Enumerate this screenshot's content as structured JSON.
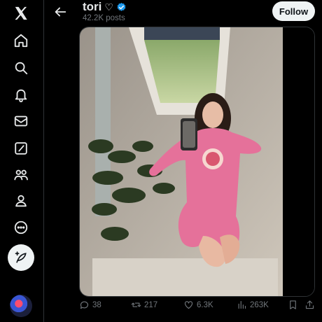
{
  "sidebar": {
    "items": [
      {
        "icon": "x-logo-icon"
      },
      {
        "icon": "home-icon"
      },
      {
        "icon": "search-icon"
      },
      {
        "icon": "bell-icon"
      },
      {
        "icon": "mail-icon"
      },
      {
        "icon": "grok-icon"
      },
      {
        "icon": "communities-icon"
      },
      {
        "icon": "profile-icon"
      },
      {
        "icon": "more-icon"
      }
    ],
    "compose_icon": "compose-post-icon"
  },
  "header": {
    "name": "tori",
    "heart": "♡",
    "posts": "42.2K posts",
    "follow_label": "Follow",
    "verified_color": "#1d9bf0"
  },
  "actions": {
    "replies": "38",
    "reposts": "217",
    "likes": "6.3K",
    "views": "263K"
  }
}
